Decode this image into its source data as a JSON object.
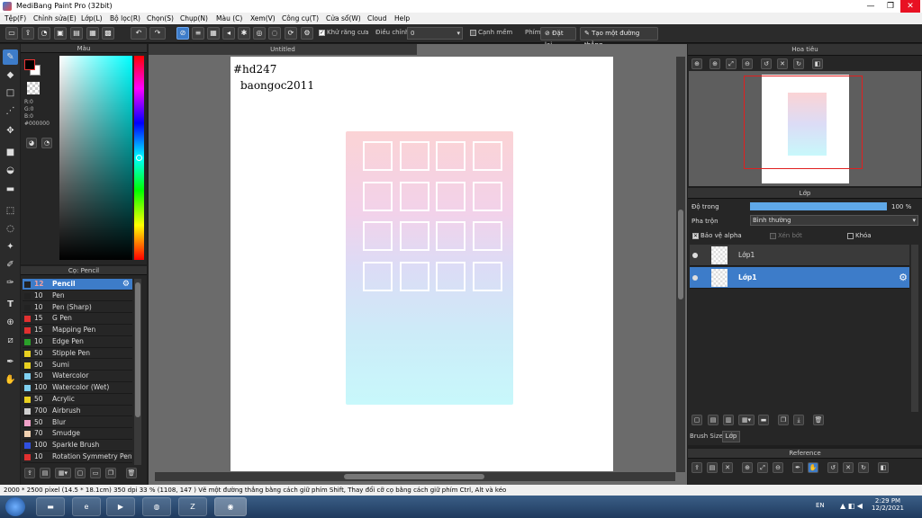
{
  "window": {
    "title": "MediBang Paint Pro (32bit)",
    "minimize": "—",
    "maximize": "❐",
    "close": "✕"
  },
  "menu": [
    "Tệp(F)",
    "Chỉnh sửa(E)",
    "Lớp(L)",
    "Bộ lọc(R)",
    "Chọn(S)",
    "Chụp(N)",
    "Màu (C)",
    "Xem(V)",
    "Công cụ(T)",
    "Cửa sổ(W)",
    "Cloud",
    "Help"
  ],
  "toolbar": {
    "antialias_label": "Khử răng cưa",
    "antialias_checked": true,
    "correction_label": "Điều chỉnh",
    "correction_value": "0",
    "smooth_edge_label": "Cạnh mềm",
    "key_label": "Phím",
    "reset_label": "Đặt lại",
    "straight_line_label": "Tạo một đường thẳng"
  },
  "color_panel": {
    "title": "Màu",
    "r": "R:0",
    "g": "G:0",
    "b": "B:0",
    "hex": "#000000",
    "primary": "#000000",
    "secondary": "#ffffff"
  },
  "brush_panel": {
    "title": "Cọ: Pencil",
    "items": [
      {
        "size": "12",
        "name": "Pencil",
        "color": "#222222"
      },
      {
        "size": "10",
        "name": "Pen",
        "color": "#222222"
      },
      {
        "size": "10",
        "name": "Pen (Sharp)",
        "color": "#222222"
      },
      {
        "size": "15",
        "name": "G Pen",
        "color": "#e03030"
      },
      {
        "size": "15",
        "name": "Mapping Pen",
        "color": "#e03030"
      },
      {
        "size": "10",
        "name": "Edge Pen",
        "color": "#2aa02a"
      },
      {
        "size": "50",
        "name": "Stipple Pen",
        "color": "#e8d020"
      },
      {
        "size": "50",
        "name": "Sumi",
        "color": "#e8d020"
      },
      {
        "size": "50",
        "name": "Watercolor",
        "color": "#7fd0f0"
      },
      {
        "size": "100",
        "name": "Watercolor (Wet)",
        "color": "#7fd0f0"
      },
      {
        "size": "50",
        "name": "Acrylic",
        "color": "#e8d020"
      },
      {
        "size": "700",
        "name": "Airbrush",
        "color": "#cfcfcf"
      },
      {
        "size": "50",
        "name": "Blur",
        "color": "#f0a0c8"
      },
      {
        "size": "70",
        "name": "Smudge",
        "color": "#f0d0b0"
      },
      {
        "size": "100",
        "name": "Sparkle Brush",
        "color": "#3050e0"
      },
      {
        "size": "10",
        "name": "Rotation Symmetry Pen",
        "color": "#e03030"
      }
    ]
  },
  "canvas": {
    "tab": "Untitled",
    "text_line1": "#hd247",
    "text_line2": "baongoc2011",
    "grid_rows": 4,
    "grid_cols": 4
  },
  "navigator": {
    "title": "Hoa tiêu"
  },
  "layer_panel": {
    "title": "Lớp",
    "opacity_label": "Độ trong",
    "opacity_value": "100 %",
    "opacity_fraction": 1.0,
    "blend_label": "Pha trộn",
    "blend_value": "Bình thường",
    "protect_alpha_label": "Bảo vệ alpha",
    "protect_alpha_checked": true,
    "clipping_label": "Xén bớt",
    "lock_label": "Khóa",
    "layers": [
      {
        "name": "Lớp1",
        "selected": false
      },
      {
        "name": "Lớp1",
        "selected": true
      }
    ],
    "tab_brush_size": "Brush Size",
    "tab_layer": "Lớp"
  },
  "reference": {
    "title": "Reference"
  },
  "statusbar": "2000 * 2500 pixel   (14.5 * 18.1cm)   350 dpi   33 %   (1108, 147 )   Vẽ một đường thẳng bằng cách giữ phím Shift, Thay đổi cỡ cọ bằng cách giữ phím Ctrl, Alt và kéo",
  "taskbar": {
    "lang": "EN",
    "time": "2:29 PM",
    "date": "12/2/2021",
    "apps": [
      "Explorer",
      "Internet Explorer",
      "Media",
      "Browser",
      "Zalo",
      "Chrome"
    ]
  }
}
